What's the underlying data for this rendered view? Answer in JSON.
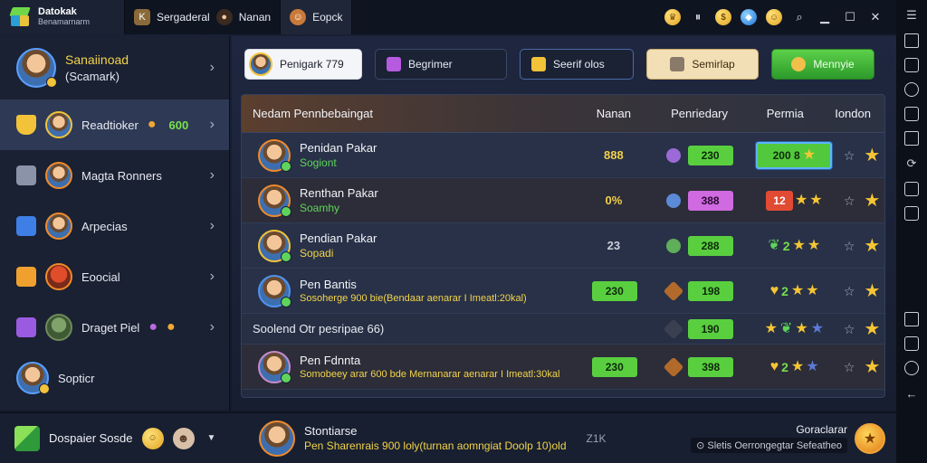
{
  "app": {
    "title": "Datokak",
    "subtitle": "Benamarnarm"
  },
  "tabs": [
    {
      "label": "Sergaderal"
    },
    {
      "label": "Nanan"
    },
    {
      "label": "Eopck"
    }
  ],
  "profile": {
    "name": "Sanaiinoad",
    "sub": "(Scamark)"
  },
  "sidebar": {
    "items": [
      {
        "label": "Readtioker",
        "extra": "600"
      },
      {
        "label": "Magta Ronners"
      },
      {
        "label": "Arpecias"
      },
      {
        "label": "Eoocial"
      },
      {
        "label": "Draget Piel"
      },
      {
        "label": "Sopticr"
      }
    ]
  },
  "toolbar": {
    "search_value": "Penigark 779",
    "b2": "Begrimer",
    "b3": "Seerif olos",
    "b4": "Semirlap",
    "b5": "Mennyie"
  },
  "table": {
    "headers": [
      "Nedam Pennbebaingat",
      "Nanan",
      "Penriedary",
      "Permia",
      "Iondon"
    ],
    "rows": [
      {
        "name": "Penidan Pakar",
        "status": "Sogiont",
        "v1": "888",
        "pill": "230",
        "perm": "200 8"
      },
      {
        "name": "Renthan Pakar",
        "status": "Soamhy",
        "v1": "0%",
        "pill": "388",
        "perm": "12"
      },
      {
        "name": "Pendian Pakar",
        "status": "Sopadi",
        "v1": "23",
        "pill": "288",
        "perm": "2"
      },
      {
        "name": "Pen Bantis",
        "status": "Sosoherge 900 bie(Bendaar aenarar I Imeatl:20kal)",
        "v1": "230",
        "pill": "198",
        "perm": "2"
      }
    ],
    "section_label": "Soolend Otr pesripae 66)",
    "section_pill": "190",
    "last_row": {
      "name": "Pen Fdnnta",
      "status": "Somobeey arar 600 bde Mernanarar aenarar I Imeatl:30kal",
      "v1": "230",
      "pill": "398",
      "perm": "2"
    }
  },
  "bottom": {
    "label": "Dospaier Sosde",
    "title": "Stontiarse",
    "sub": "Pen Sharenrais 900 loly(turnan aomngiat Doolp 10)old",
    "code": "Z1K",
    "right_top": "Goraclarar",
    "right_sub": "Sletis Oerrongegtar Sefeatheo"
  }
}
